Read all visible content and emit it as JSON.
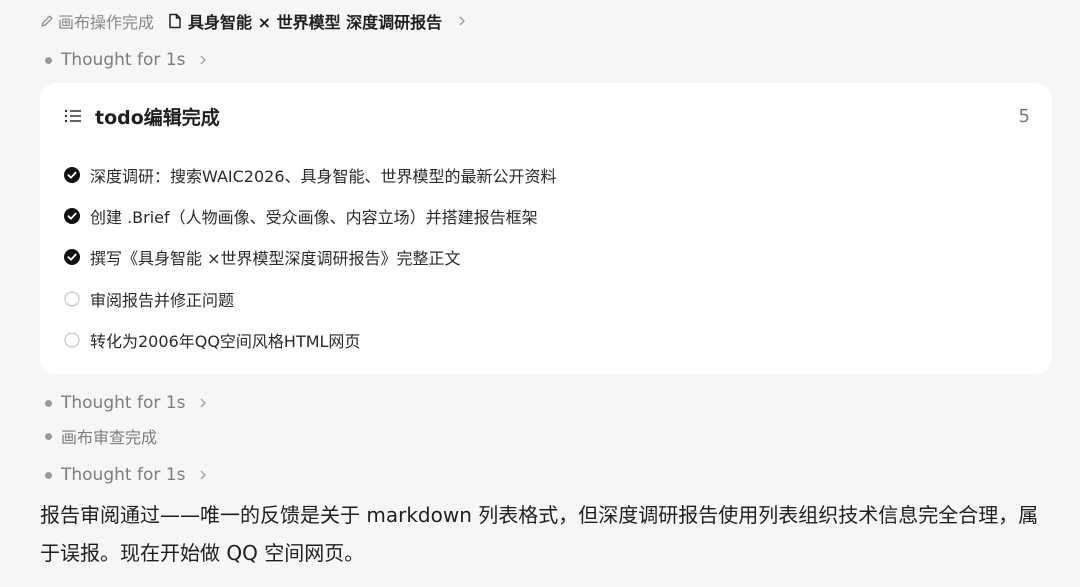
{
  "breadcrumb": {
    "status": "画布操作完成",
    "doc_title": "具身智能 × 世界模型 深度调研报告"
  },
  "thoughts": [
    "Thought for 1s",
    "Thought for 1s",
    "Thought for 1s"
  ],
  "canvas_review_status": "画布审查完成",
  "todo_card": {
    "title": "todo编辑完成",
    "count": "5",
    "items": [
      {
        "text": "深度调研：搜索WAIC2026、具身智能、世界模型的最新公开资料",
        "done": true
      },
      {
        "text": "创建 .Brief（人物画像、受众画像、内容立场）并搭建报告框架",
        "done": true
      },
      {
        "text": "撰写《具身智能 ×世界模型深度调研报告》完整正文",
        "done": true
      },
      {
        "text": "审阅报告并修正问题",
        "done": false
      },
      {
        "text": "转化为2006年QQ空间风格HTML网页",
        "done": false
      }
    ]
  },
  "message": "报告审阅通过——唯一的反馈是关于 markdown 列表格式，但深度调研报告使用列表组织技术信息完全合理，属于误报。现在开始做 QQ 空间网页。",
  "icons": {
    "status": "pencil-icon",
    "document": "document-icon",
    "list": "list-icon",
    "expand": "chevron-right-icon",
    "done": "check-circle-icon",
    "pending": "empty-circle-icon"
  }
}
